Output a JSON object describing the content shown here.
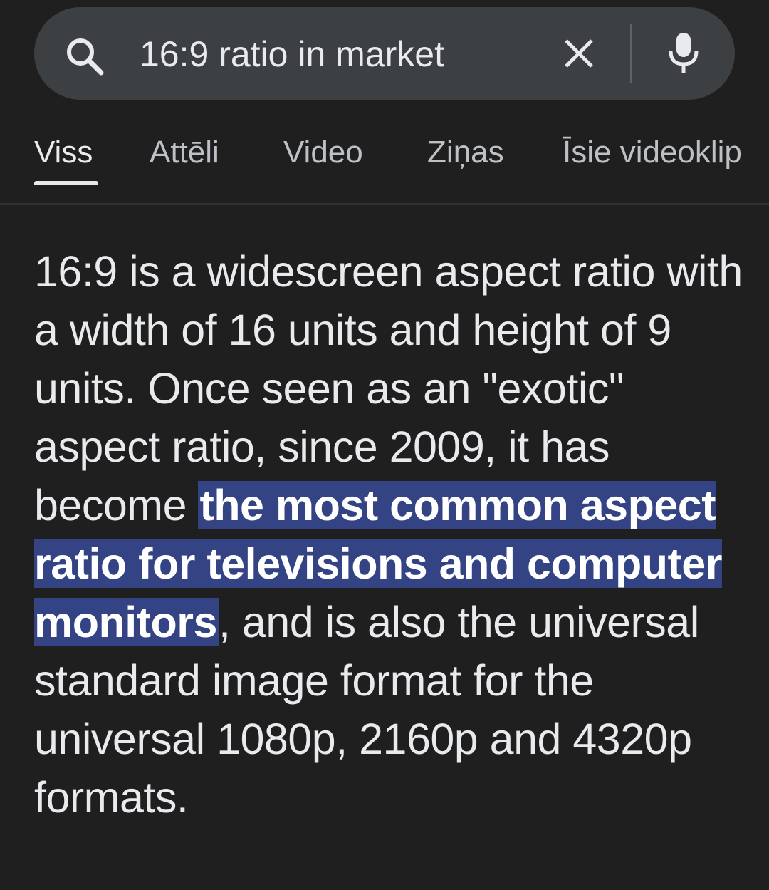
{
  "search": {
    "query": "16:9 ratio in market"
  },
  "tabs": [
    {
      "label": "Viss",
      "active": true
    },
    {
      "label": "Attēli",
      "active": false
    },
    {
      "label": "Video",
      "active": false
    },
    {
      "label": "Ziņas",
      "active": false
    },
    {
      "label": "Īsie videoklip",
      "active": false
    }
  ],
  "snippet": {
    "text_before": "16:9 is a widescreen aspect ratio with a width of 16 units and height of 9 units. Once seen as an \"exotic\" aspect ratio, since 2009, it has become ",
    "highlight": "the most common aspect ratio for televisions and computer monitors",
    "text_after": ", and is also the universal standard image format for the universal 1080p, 2160p and 4320p formats."
  },
  "icons": {
    "search": "search-icon",
    "clear": "close-icon",
    "mic": "microphone-icon"
  },
  "colors": {
    "background": "#1f1f1f",
    "search_bar": "#3c4043",
    "highlight": "#334384"
  }
}
